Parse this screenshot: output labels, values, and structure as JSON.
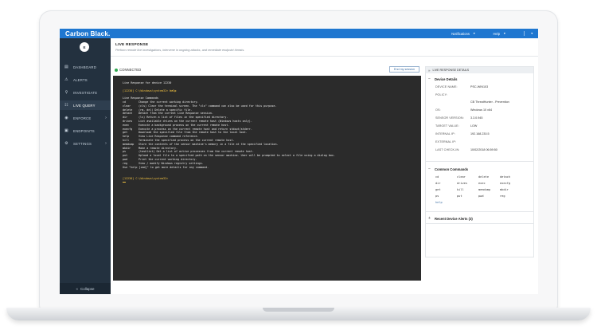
{
  "app": {
    "brand": "Carbon Black.",
    "nav": {
      "notifications": "Notifications",
      "help": "Help"
    }
  },
  "sidebar": {
    "avatar": "E",
    "items": [
      {
        "label": "DASHBOARD",
        "icon": "dashboard-icon"
      },
      {
        "label": "ALERTS",
        "icon": "alerts-icon"
      },
      {
        "label": "INVESTIGATE",
        "icon": "investigate-icon"
      },
      {
        "label": "LIVE QUERY",
        "icon": "live-query-icon"
      },
      {
        "label": "ENFORCE",
        "icon": "enforce-icon"
      },
      {
        "label": "ENDPOINTS",
        "icon": "endpoints-icon"
      },
      {
        "label": "SETTINGS",
        "icon": "settings-icon"
      }
    ],
    "collapse": "Collapse"
  },
  "page": {
    "title": "LIVE RESPONSE",
    "subtitle": "Perform remote live investigations, intervene in ongoing attacks, and remediate endpoint threats."
  },
  "session": {
    "status": "CONNECTED",
    "end_button": "End my session"
  },
  "terminal": {
    "header": "Live Response for device 12230",
    "prompt": "[12230] C:\\Windows\\system32>",
    "command": "help",
    "commands_title": "Live Response Commands",
    "commands": [
      {
        "cmd": "cd",
        "desc": "Change the current working directory."
      },
      {
        "cmd": "clear",
        "desc": "(cls) Clear the terminal screen. The \"cls\" command can also be used for this purpose."
      },
      {
        "cmd": "delete",
        "desc": "(rm, del) Delete a specific file."
      },
      {
        "cmd": "detach",
        "desc": "Detach from the current Live Response session."
      },
      {
        "cmd": "dir",
        "desc": "(ls) Return a list of files in the specified directory."
      },
      {
        "cmd": "drives",
        "desc": "List available drives on the current remote host (Windows hosts only)."
      },
      {
        "cmd": "exec",
        "desc": "Execute a background process on the current remote host."
      },
      {
        "cmd": "execfg",
        "desc": "Execute a process on the current remote host and return stdout/stderr."
      },
      {
        "cmd": "get",
        "desc": "Download the specified file from the remote host to the local host."
      },
      {
        "cmd": "help",
        "desc": "View Live Response command reference."
      },
      {
        "cmd": "kill",
        "desc": "Terminate the specified process on the current remote host."
      },
      {
        "cmd": "memdump",
        "desc": "Store the contents of the sensor machine's memory in a file at the specified location."
      },
      {
        "cmd": "mkdir",
        "desc": "Make a remote directory."
      },
      {
        "cmd": "ps",
        "desc": "(tasklist) Get a list of active processes from the current remote host."
      },
      {
        "cmd": "put",
        "desc": "Upload a local file to a specified path on the sensor machine. User will be prompted to select a file using a dialog box."
      },
      {
        "cmd": "pwd",
        "desc": "Print the current working directory."
      },
      {
        "cmd": "reg",
        "desc": "View / modify Windows registry settings."
      }
    ],
    "footer": "Use \"help [cmd]\" to get more details for any command."
  },
  "details": {
    "panel_title": "LIVE RESPONSE DETAILS",
    "device_details_title": "Device Details",
    "rows": [
      {
        "key": "DEVICE NAME:",
        "value": "PSC-WIN103"
      },
      {
        "key": "POLICY:",
        "value": ""
      },
      {
        "key": "",
        "value": "CB ThreatHunter - Prevention"
      },
      {
        "key": "OS:",
        "value": "Windows 10 x64"
      },
      {
        "key": "SENSOR VERSION:",
        "value": "3.3.0.945"
      },
      {
        "key": "TARGET VALUE:",
        "value": "LOW"
      },
      {
        "key": "INTERNAL IP:",
        "value": "192.168.230.5"
      },
      {
        "key": "EXTERNAL IP:",
        "value": ""
      },
      {
        "key": "LAST CHECK-IN:",
        "value": "10/02/2018 06:59:50"
      }
    ],
    "common_commands_title": "Common Commands",
    "common_commands": [
      [
        "cd",
        "clear",
        "delete",
        "detach"
      ],
      [
        "dir",
        "drives",
        "exec",
        "execfg"
      ],
      [
        "get",
        "kill",
        "memdump",
        "mkdir"
      ],
      [
        "ps",
        "put",
        "pwd",
        "reg"
      ]
    ],
    "help_link": "help",
    "recent_alerts": "Recent Device Alerts (3)"
  }
}
